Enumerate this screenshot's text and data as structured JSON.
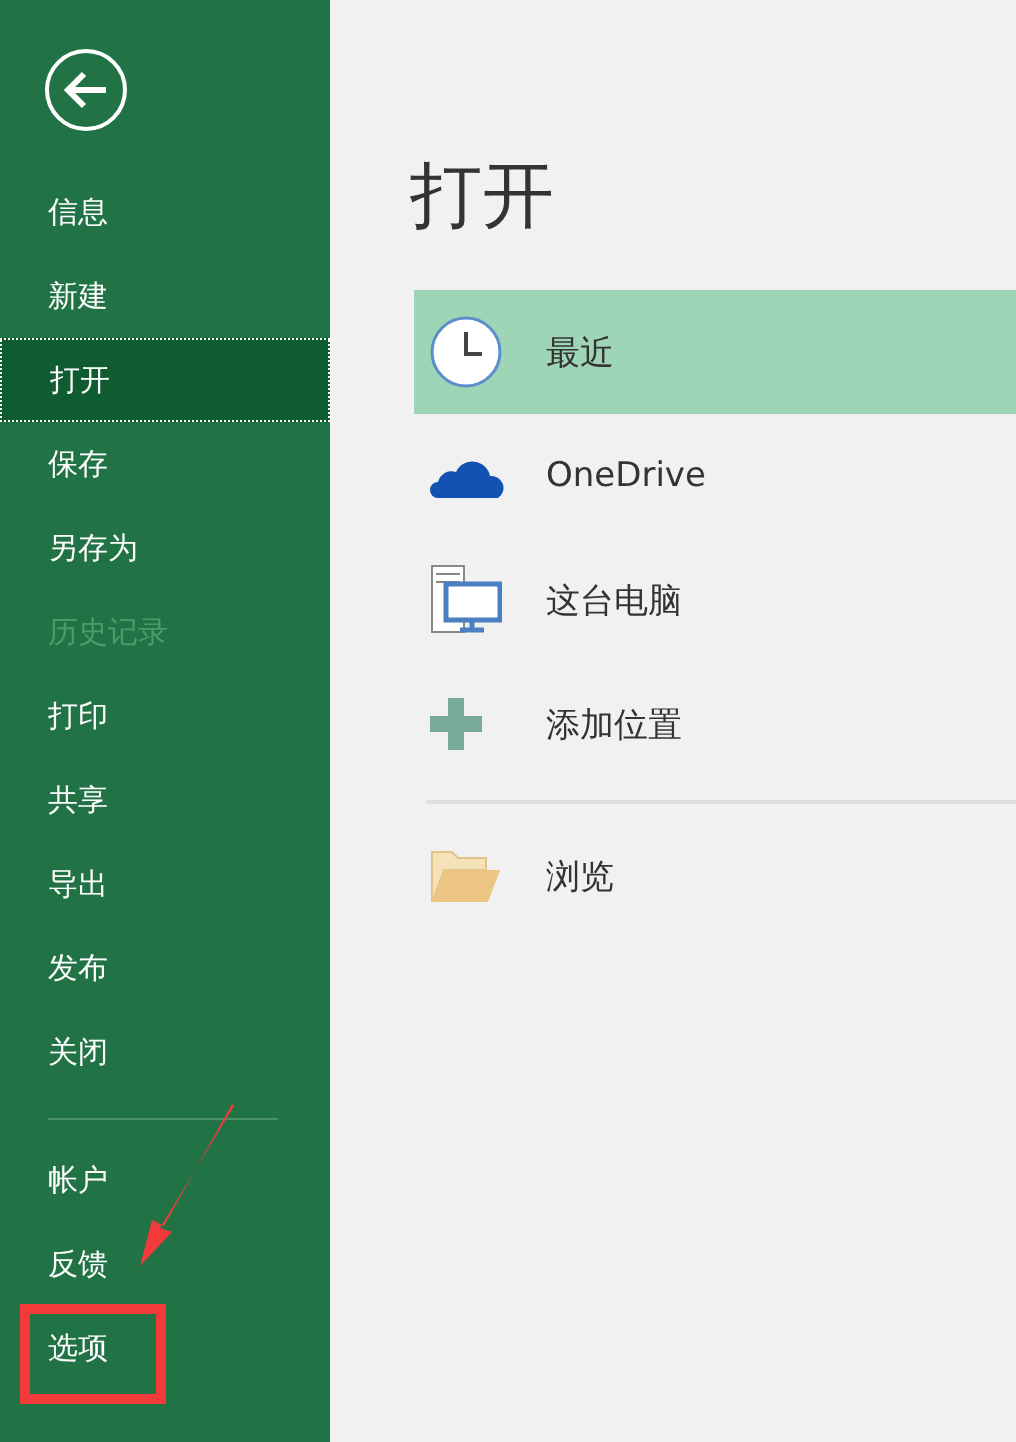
{
  "sidebar": {
    "items": [
      {
        "label": "信息",
        "selected": false,
        "disabled": false
      },
      {
        "label": "新建",
        "selected": false,
        "disabled": false
      },
      {
        "label": "打开",
        "selected": true,
        "disabled": false
      },
      {
        "label": "保存",
        "selected": false,
        "disabled": false
      },
      {
        "label": "另存为",
        "selected": false,
        "disabled": false
      },
      {
        "label": "历史记录",
        "selected": false,
        "disabled": true
      },
      {
        "label": "打印",
        "selected": false,
        "disabled": false
      },
      {
        "label": "共享",
        "selected": false,
        "disabled": false
      },
      {
        "label": "导出",
        "selected": false,
        "disabled": false
      },
      {
        "label": "发布",
        "selected": false,
        "disabled": false
      },
      {
        "label": "关闭",
        "selected": false,
        "disabled": false
      }
    ],
    "bottom_items": [
      {
        "label": "帐户",
        "selected": false,
        "disabled": false
      },
      {
        "label": "反馈",
        "selected": false,
        "disabled": false
      },
      {
        "label": "选项",
        "selected": false,
        "disabled": false
      }
    ]
  },
  "main": {
    "title": "打开",
    "locations": [
      {
        "label": "最近",
        "kind": "clock",
        "selected": true
      },
      {
        "label": "OneDrive",
        "kind": "cloud",
        "selected": false
      },
      {
        "label": "这台电脑",
        "kind": "computer",
        "selected": false
      },
      {
        "label": "添加位置",
        "kind": "add",
        "selected": false
      }
    ],
    "browse": [
      {
        "label": "浏览",
        "kind": "folder",
        "selected": false
      }
    ]
  }
}
